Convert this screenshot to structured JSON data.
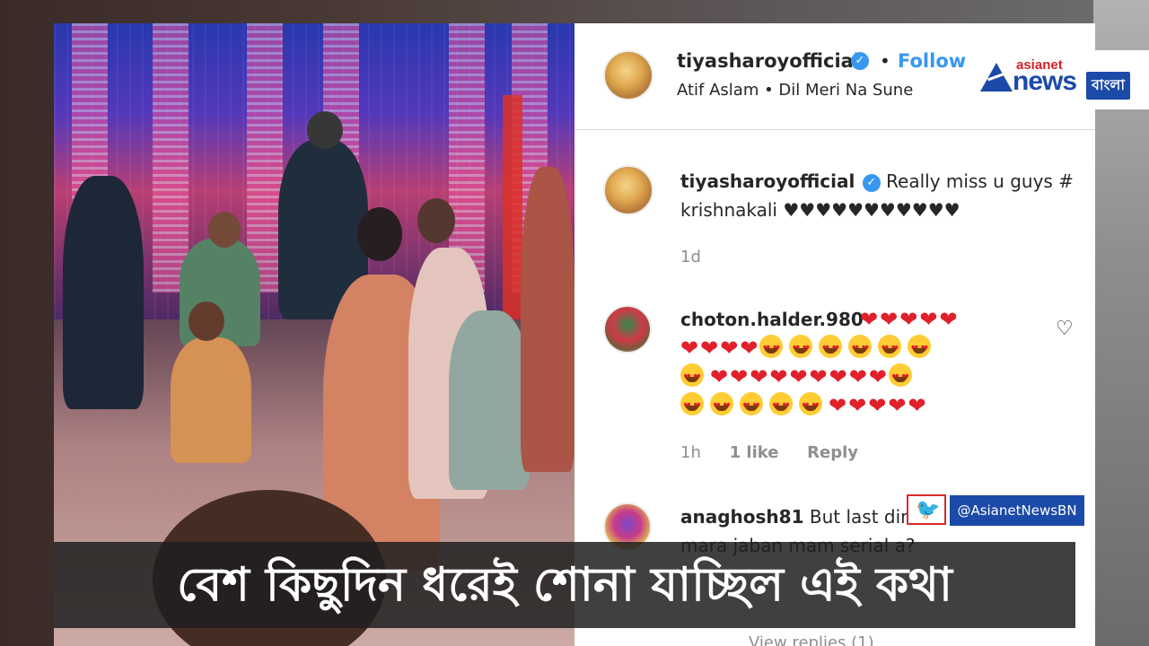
{
  "post": {
    "username": "tiyasharoyofficial",
    "verified_icon": "verified-badge-icon",
    "separator": "•",
    "follow_label": "Follow",
    "audio": "Atif Aslam • Dil Meri Na Sune"
  },
  "caption_comment": {
    "username": "tiyasharoyofficial",
    "text": "Really miss u guys # krishnakali ♥♥♥♥♥♥♥♥♥♥♥",
    "time": "1d"
  },
  "comments": [
    {
      "username": "choton.halder.980",
      "emoji_rows": [
        [
          "heart",
          "heart",
          "heart",
          "heart",
          "heart"
        ],
        [
          "heart",
          "heart",
          "heart",
          "heart",
          "face",
          "face",
          "face",
          "face",
          "face",
          "face"
        ],
        [
          "face",
          "heart",
          "heart",
          "heart",
          "heart",
          "heart",
          "heart",
          "heart",
          "heart",
          "heart",
          "face"
        ],
        [
          "face",
          "face",
          "face",
          "face",
          "face",
          "heart",
          "heart",
          "heart",
          "heart",
          "heart"
        ]
      ],
      "time": "1h",
      "likes": "1 like",
      "reply_label": "Reply"
    },
    {
      "username": "anaghosh81",
      "text_visible": "But last din",
      "text_line2": "mara jaban mam serial a?",
      "view_replies": "View replies (1)"
    }
  ],
  "logo": {
    "line1": "asianet",
    "line2": "news",
    "badge": "বাংলা"
  },
  "twitter": {
    "icon": "twitter-bird-icon",
    "handle": "@AsianetNewsBN"
  },
  "caption_bar": {
    "text": "বেশ কিছুদিন ধরেই শোনা যাচ্ছিল এই কথা"
  },
  "colors": {
    "link_blue": "#3897f0",
    "brand_blue": "#1c4aa8",
    "brand_red": "#d8202a"
  }
}
